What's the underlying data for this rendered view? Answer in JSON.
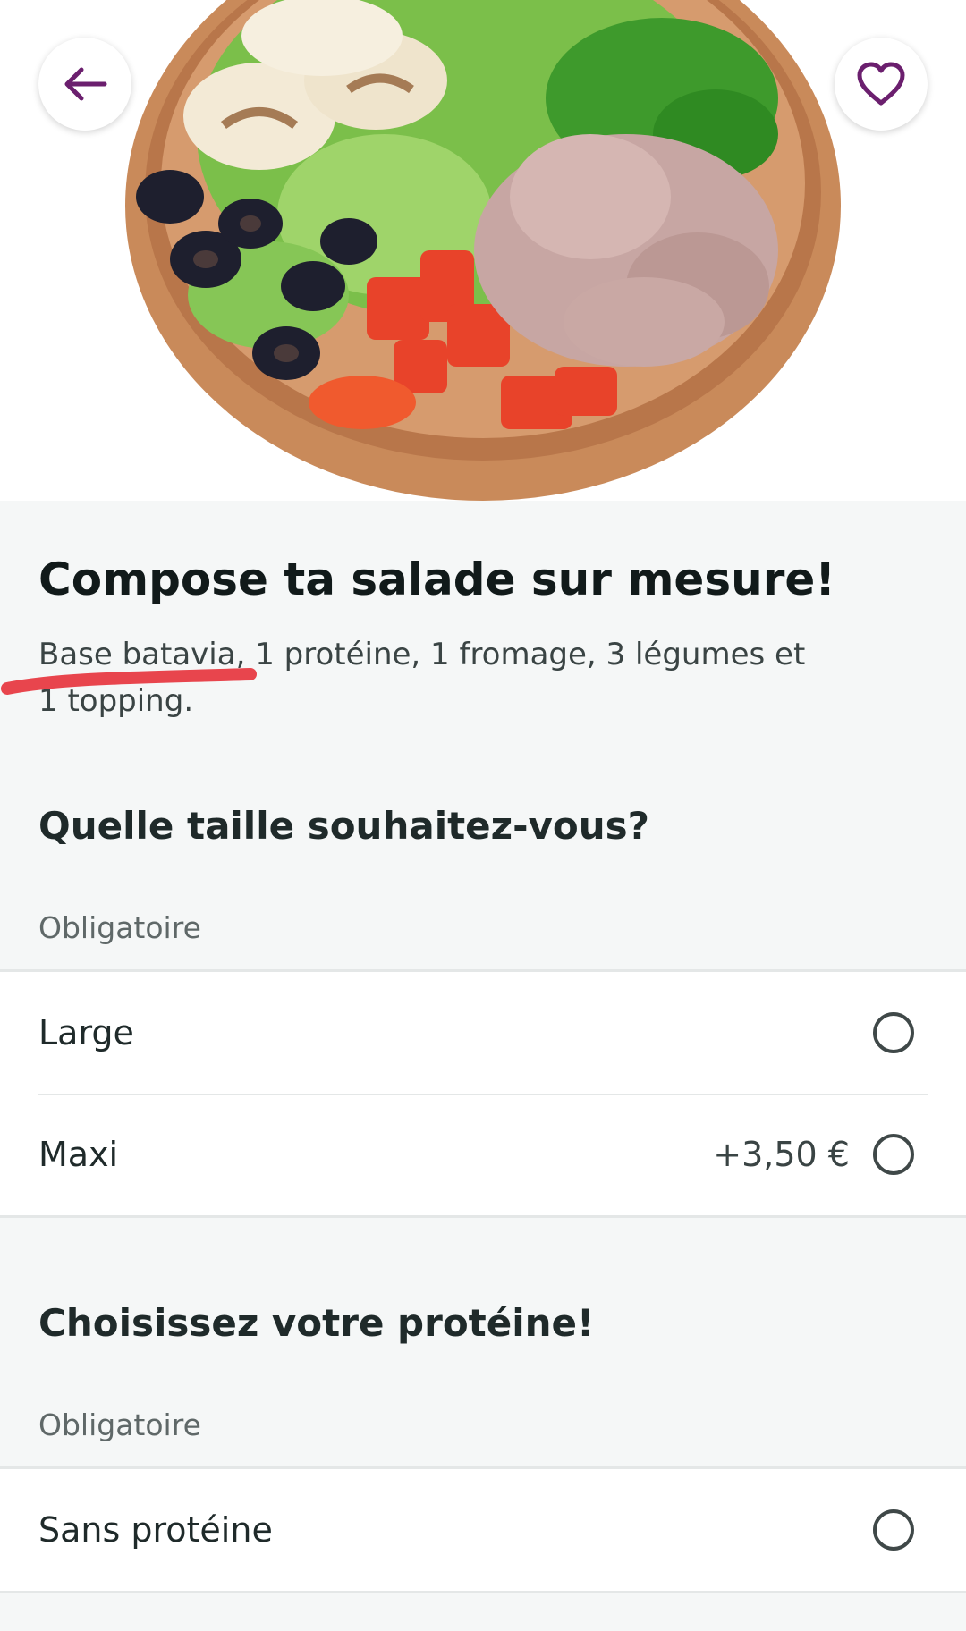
{
  "header": {
    "back_icon": "arrow-left-icon",
    "favorite_icon": "heart-outline-icon",
    "accent_color": "#6b1f6e"
  },
  "product": {
    "title": "Compose ta salade sur mesure!",
    "description": "Base batavia, 1 protéine, 1 fromage, 3 légumes et 1 topping."
  },
  "sections": [
    {
      "heading": "Quelle taille souhaitez-vous?",
      "note": "Obligatoire",
      "options": [
        {
          "label": "Large",
          "price": ""
        },
        {
          "label": "Maxi",
          "price": "+3,50 €"
        }
      ]
    },
    {
      "heading": "Choisissez votre protéine!",
      "note": "Obligatoire",
      "options": [
        {
          "label": "Sans protéine",
          "price": ""
        }
      ]
    }
  ],
  "annotation_color": "#e8454d"
}
